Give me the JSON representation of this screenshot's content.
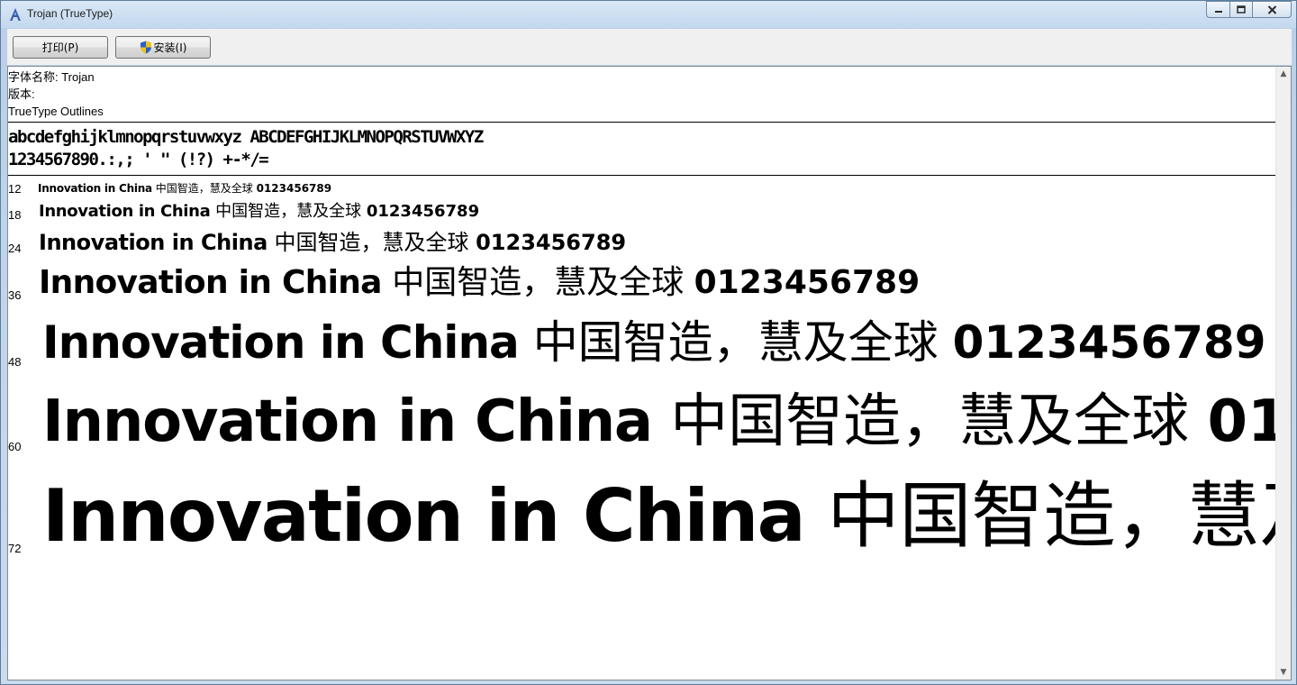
{
  "window": {
    "title": "Trojan (TrueType)"
  },
  "toolbar": {
    "print_label": "打印(P)",
    "install_label": "安装(I)"
  },
  "info": {
    "font_name": "字体名称: Trojan",
    "version": "版本:",
    "outline_type": "TrueType Outlines"
  },
  "charset": {
    "line1": "abcdefghijklmnopqrstuvwxyz ABCDEFGHIJKLMNOPQRSTUVWXYZ",
    "line2": "1234567890.:,; ' \" (!?) +-*/="
  },
  "samples": {
    "latin": "Innovation in China",
    "cjk": "中国智造，慧及全球",
    "digits": "0123456789",
    "sizes": [
      {
        "label": "12"
      },
      {
        "label": "18"
      },
      {
        "label": "24"
      },
      {
        "label": "36"
      },
      {
        "label": "48"
      },
      {
        "label": "60"
      },
      {
        "label": "72"
      }
    ]
  },
  "icons": {
    "app": "font-icon",
    "install": "shield-icon",
    "minimize": "minimize-icon",
    "maximize": "maximize-icon",
    "close": "close-icon"
  }
}
